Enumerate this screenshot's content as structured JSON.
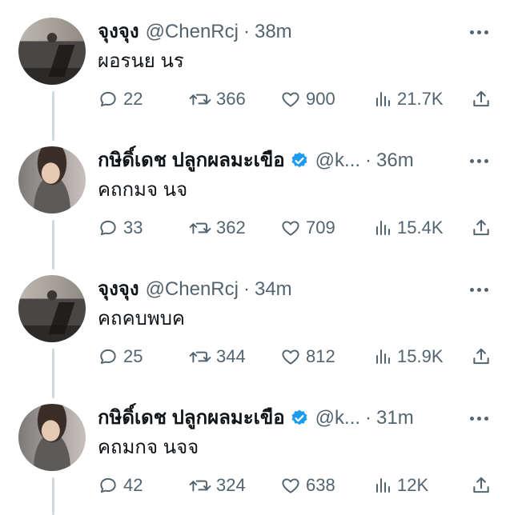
{
  "tweets": [
    {
      "name": "จุงจุง",
      "handle": "@ChenRcj",
      "separator": "·",
      "time": "38m",
      "verified": false,
      "text": "ผอรนย นร",
      "replies": "22",
      "retweets": "366",
      "likes": "900",
      "views": "21.7K"
    },
    {
      "name": "กษิดิ์เดช ปลูกผลมะเขือ",
      "handle": "@k...",
      "separator": "·",
      "time": "36m",
      "verified": true,
      "text": "คถกมจ นจ",
      "replies": "33",
      "retweets": "362",
      "likes": "709",
      "views": "15.4K"
    },
    {
      "name": "จุงจุง",
      "handle": "@ChenRcj",
      "separator": "·",
      "time": "34m",
      "verified": false,
      "text": "คถคบพบค",
      "replies": "25",
      "retweets": "344",
      "likes": "812",
      "views": "15.9K"
    },
    {
      "name": "กษิดิ์เดช ปลูกผลมะเขือ",
      "handle": "@k...",
      "separator": "·",
      "time": "31m",
      "verified": true,
      "text": "คถมกจ นจจ",
      "replies": "42",
      "retweets": "324",
      "likes": "638",
      "views": "12K"
    }
  ],
  "colors": {
    "text_primary": "#0f1419",
    "text_secondary": "#536471",
    "verified_blue": "#1d9bf0",
    "thread_line": "#cfd9de"
  },
  "icons": {
    "reply": "speech-bubble-icon",
    "retweet": "retweet-arrows-icon",
    "like": "heart-icon",
    "views": "bar-chart-icon",
    "share": "share-upload-icon",
    "more": "more-dots-icon",
    "verified": "verified-badge-icon"
  }
}
